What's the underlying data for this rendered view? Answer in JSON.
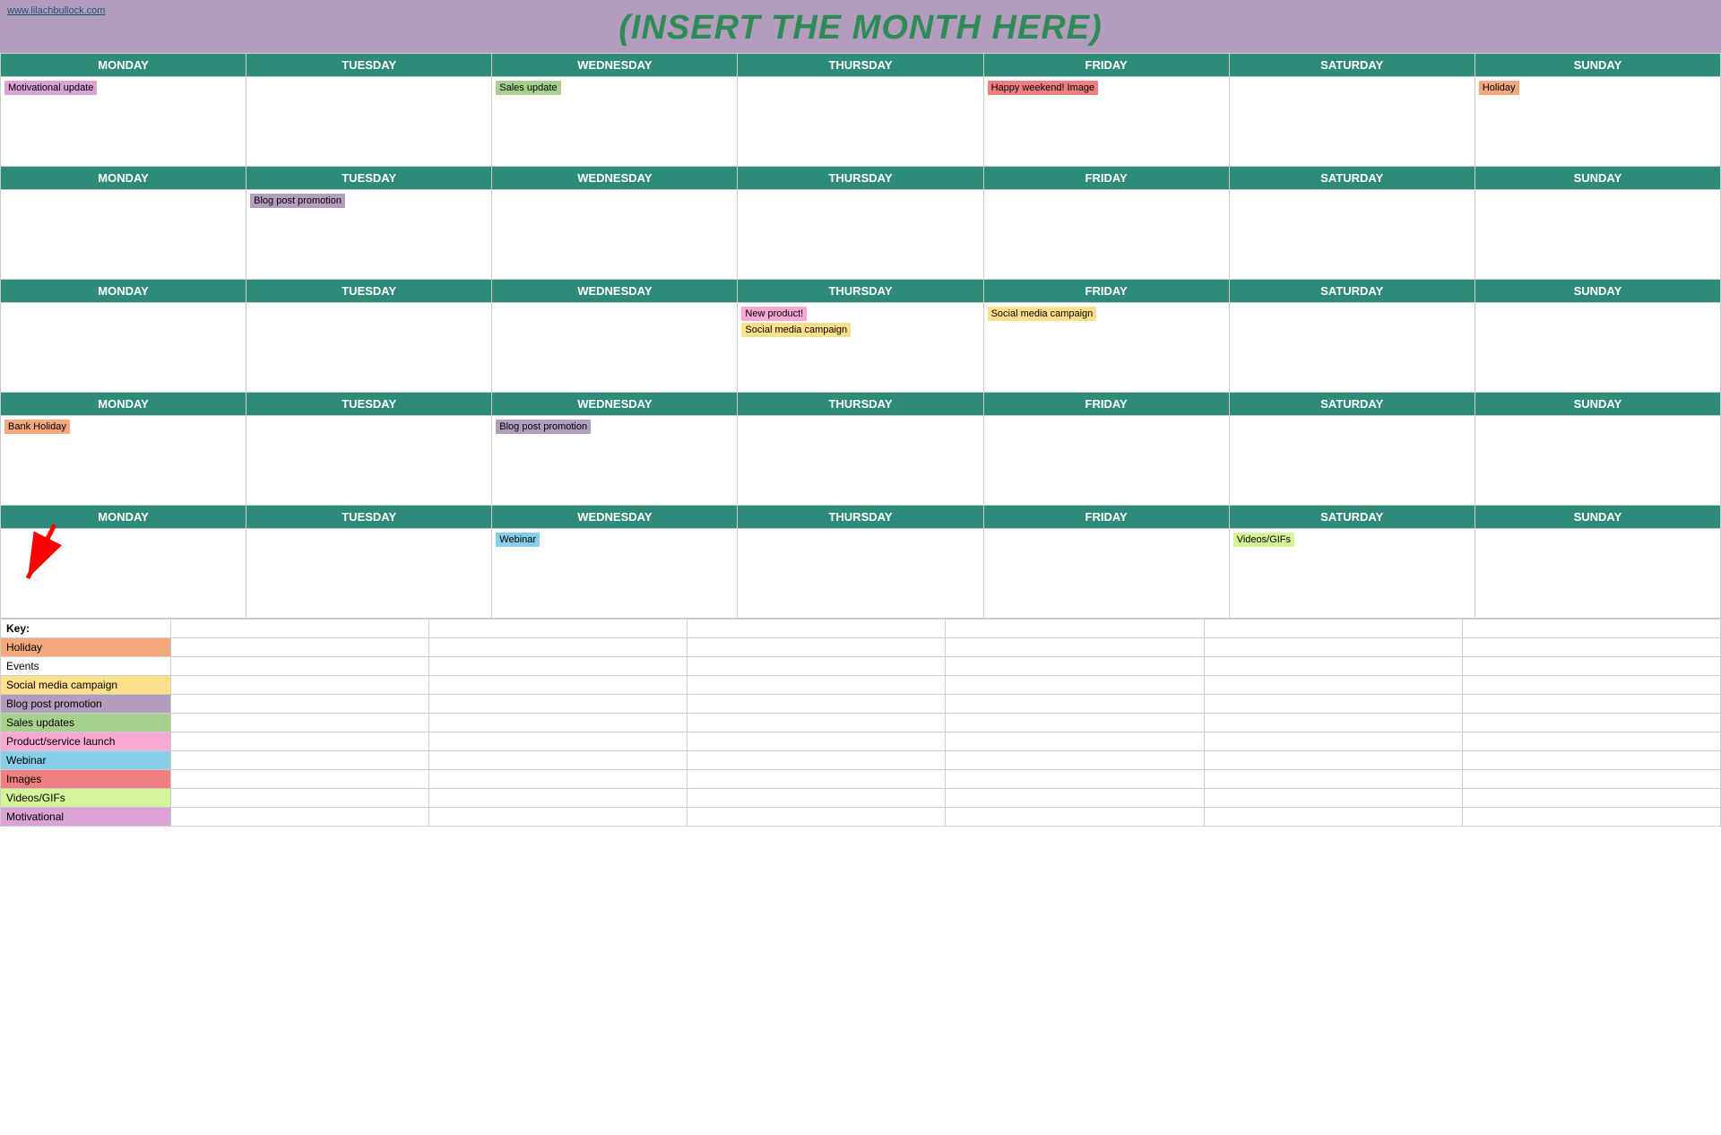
{
  "header": {
    "title": "(INSERT THE MONTH HERE)",
    "website": "www.lilachbullock.com"
  },
  "days": [
    "MONDAY",
    "TUESDAY",
    "WEDNESDAY",
    "THURSDAY",
    "FRIDAY",
    "SATURDAY",
    "SUNDAY"
  ],
  "weeks": [
    {
      "cells": [
        {
          "event": "Motivational update",
          "tag": "tag-motivational"
        },
        {
          "event": "",
          "tag": ""
        },
        {
          "event": "Sales update",
          "tag": "tag-sales"
        },
        {
          "event": "",
          "tag": ""
        },
        {
          "event": "Happy weekend! Image",
          "tag": "tag-happy-weekend"
        },
        {
          "event": "",
          "tag": ""
        },
        {
          "event": "Holiday",
          "tag": "tag-holiday"
        }
      ]
    },
    {
      "cells": [
        {
          "event": "",
          "tag": ""
        },
        {
          "event": "Blog post promotion",
          "tag": "tag-blog"
        },
        {
          "event": "",
          "tag": ""
        },
        {
          "event": "",
          "tag": ""
        },
        {
          "event": "",
          "tag": ""
        },
        {
          "event": "",
          "tag": ""
        },
        {
          "event": "",
          "tag": ""
        }
      ]
    },
    {
      "cells": [
        {
          "event": "",
          "tag": ""
        },
        {
          "event": "",
          "tag": ""
        },
        {
          "event": "",
          "tag": ""
        },
        {
          "event": "New product!\nSocial media campaign",
          "tag": "tag-new-product tag-social"
        },
        {
          "event": "Social media campaign",
          "tag": "tag-social"
        },
        {
          "event": "",
          "tag": ""
        },
        {
          "event": "",
          "tag": ""
        }
      ]
    },
    {
      "cells": [
        {
          "event": "Bank Holiday",
          "tag": "tag-bank"
        },
        {
          "event": "",
          "tag": ""
        },
        {
          "event": "Blog post promotion",
          "tag": "tag-blog"
        },
        {
          "event": "",
          "tag": ""
        },
        {
          "event": "",
          "tag": ""
        },
        {
          "event": "",
          "tag": ""
        },
        {
          "event": "",
          "tag": ""
        }
      ]
    },
    {
      "cells": [
        {
          "event": "",
          "tag": ""
        },
        {
          "event": "",
          "tag": ""
        },
        {
          "event": "Webinar",
          "tag": "tag-webinar"
        },
        {
          "event": "",
          "tag": ""
        },
        {
          "event": "",
          "tag": ""
        },
        {
          "event": "Videos/GIFs",
          "tag": "tag-videos"
        },
        {
          "event": "",
          "tag": ""
        }
      ]
    }
  ],
  "key": {
    "label": "Key:",
    "items": [
      {
        "name": "Holiday",
        "tag": "tag-holiday"
      },
      {
        "name": "Events",
        "tag": ""
      },
      {
        "name": "Social media campaign",
        "tag": "tag-social"
      },
      {
        "name": "Blog post promotion",
        "tag": "tag-blog"
      },
      {
        "name": "Sales updates",
        "tag": "tag-sales"
      },
      {
        "name": "Product/service launch",
        "tag": "tag-new-product"
      },
      {
        "name": "Webinar",
        "tag": "tag-webinar"
      },
      {
        "name": "Images",
        "tag": "tag-happy-weekend"
      },
      {
        "name": "Videos/GIFs",
        "tag": "tag-videos"
      },
      {
        "name": "Motivational",
        "tag": "tag-motivational"
      }
    ]
  }
}
